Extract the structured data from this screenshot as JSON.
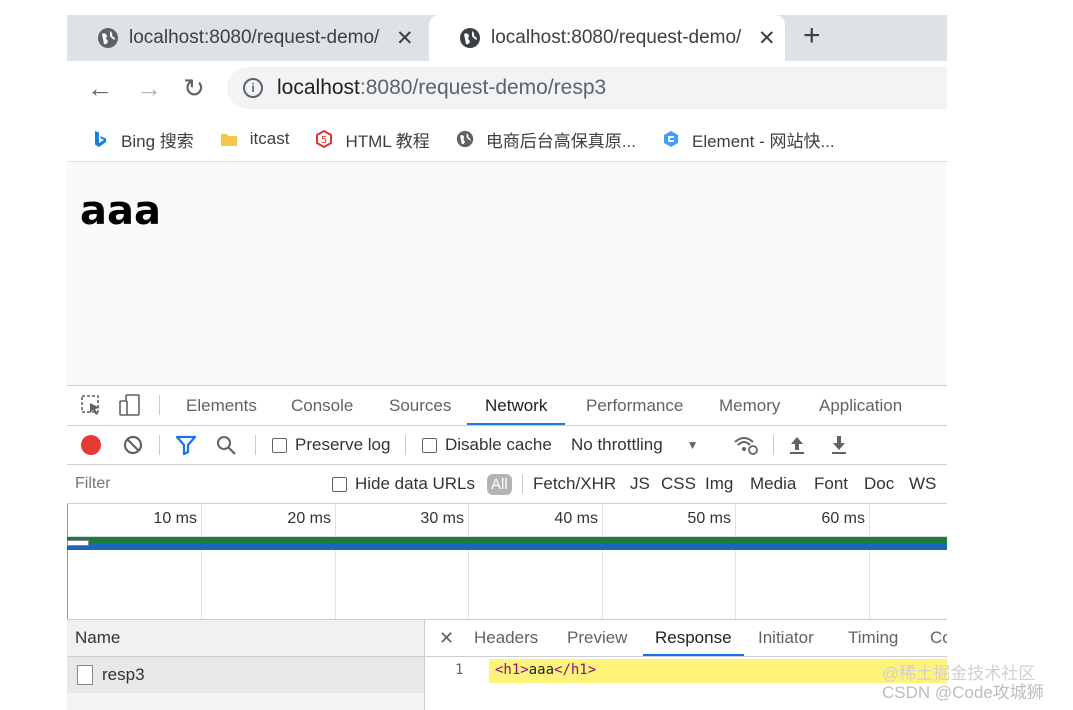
{
  "tabs": [
    {
      "title": "localhost:8080/request-demo/"
    },
    {
      "title": "localhost:8080/request-demo/"
    }
  ],
  "omnibox": {
    "host": "localhost",
    "rest": ":8080/request-demo/resp3"
  },
  "bookmarks": [
    {
      "label": "Bing 搜索",
      "icon": "bing-icon"
    },
    {
      "label": "itcast",
      "icon": "folder-icon"
    },
    {
      "label": "HTML 教程",
      "icon": "html-tutorial-icon"
    },
    {
      "label": "电商后台高保真原...",
      "icon": "globe-icon"
    },
    {
      "label": "Element - 网站快...",
      "icon": "element-icon"
    }
  ],
  "page": {
    "heading": "aaa"
  },
  "devtools": {
    "tabs": [
      "Elements",
      "Console",
      "Sources",
      "Network",
      "Performance",
      "Memory",
      "Application"
    ],
    "active_tab": "Network",
    "toolbar": {
      "preserve_log": "Preserve log",
      "disable_cache": "Disable cache",
      "throttling": "No throttling"
    },
    "filter": {
      "placeholder": "Filter",
      "hide_data_urls": "Hide data URLs",
      "all": "All",
      "types": [
        "Fetch/XHR",
        "JS",
        "CSS",
        "Img",
        "Media",
        "Font",
        "Doc",
        "WS"
      ]
    },
    "timeline_ticks": [
      "10 ms",
      "20 ms",
      "30 ms",
      "40 ms",
      "50 ms",
      "60 ms"
    ],
    "requests_header": "Name",
    "requests": [
      {
        "name": "resp3"
      }
    ],
    "detail_tabs": [
      "Headers",
      "Preview",
      "Response",
      "Initiator",
      "Timing",
      "Co"
    ],
    "active_detail_tab": "Response",
    "response": {
      "line_number": "1",
      "open_tag": "<h1>",
      "text": "aaa",
      "close_tag": "</h1>"
    }
  },
  "watermark": {
    "line1": "@稀土掘金技术社区",
    "line2": "CSDN @Code攻城狮"
  },
  "colors": {
    "record": "#e53935",
    "filter_active": "#1a73e8",
    "active_tab_underline": "#1a73e8",
    "waterfall_green": "#1e7a3a",
    "waterfall_blue": "#1a66b8",
    "response_highlight": "#fff37a"
  }
}
